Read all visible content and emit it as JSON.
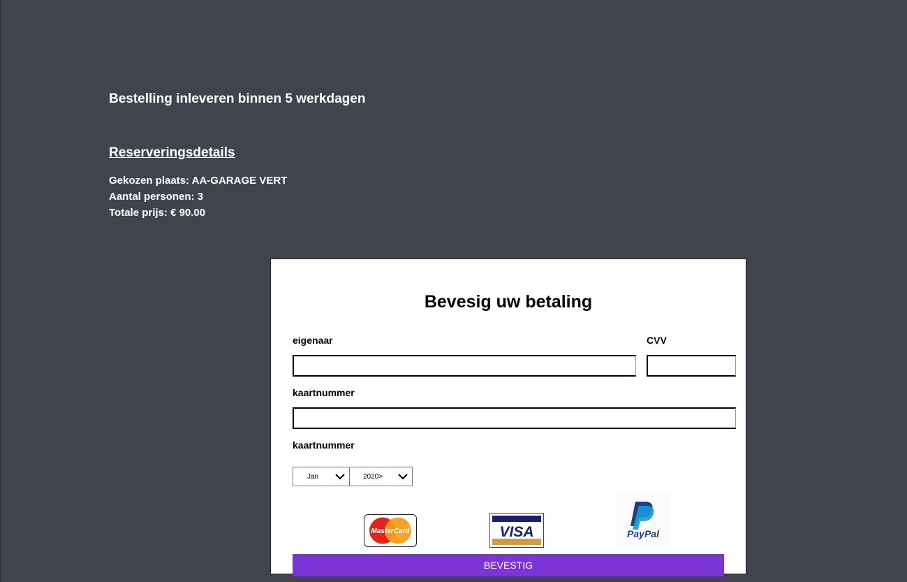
{
  "delivery_note": "Bestelling inleveren binnen 5 werkdagen",
  "details": {
    "heading": "Reserveringsdetails",
    "place": "Gekozen plaats: AA-GARAGE VERT",
    "persons": "Aantal personen: 3",
    "price": "Totale prijs: € 90.00"
  },
  "payment": {
    "title": "Bevesig uw betaling",
    "owner_label": "eigenaar",
    "owner_value": "",
    "cvv_label": "CVV",
    "cvv_value": "",
    "card_number_label": "kaartnummer",
    "card_number_value": "",
    "expiry_label": "kaartnummer",
    "month_selected": "Jan",
    "year_selected": "2020>",
    "logos": {
      "mastercard": "MasterCard",
      "visa": "VISA",
      "paypal": "PayPal"
    },
    "confirm_label": "BEVESTIG"
  },
  "colors": {
    "background": "#40444d",
    "button": "#7b35d6",
    "card": "#ffffff"
  },
  "icons": {
    "select_chevron": "chevron-down-icon"
  }
}
